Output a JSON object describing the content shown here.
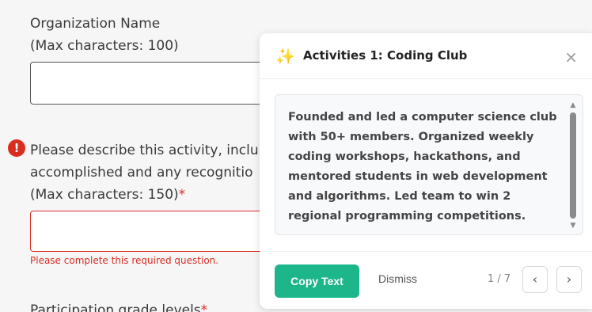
{
  "form": {
    "org_name_label": "Organization Name",
    "org_name_hint": "(Max characters: 100)",
    "description_line1": "Please describe this activity, inclu",
    "description_line2": "accomplished and any recognitio",
    "description_hint": "(Max characters: 150)",
    "required_mark": "*",
    "error_message": "Please complete this required question.",
    "participation_label": "Participation grade levels"
  },
  "panel": {
    "title": "Activities 1: Coding Club",
    "close_glyph": "×",
    "text": "Founded and led a computer science club with 50+ members. Organized weekly coding workshops, hackathons, and mentored students in web development and algorithms. Led team to win 2 regional programming competitions.",
    "copy_label": "Copy Text",
    "dismiss_label": "Dismiss",
    "pager": "1 / 7",
    "prev_glyph": "‹",
    "next_glyph": "›"
  }
}
